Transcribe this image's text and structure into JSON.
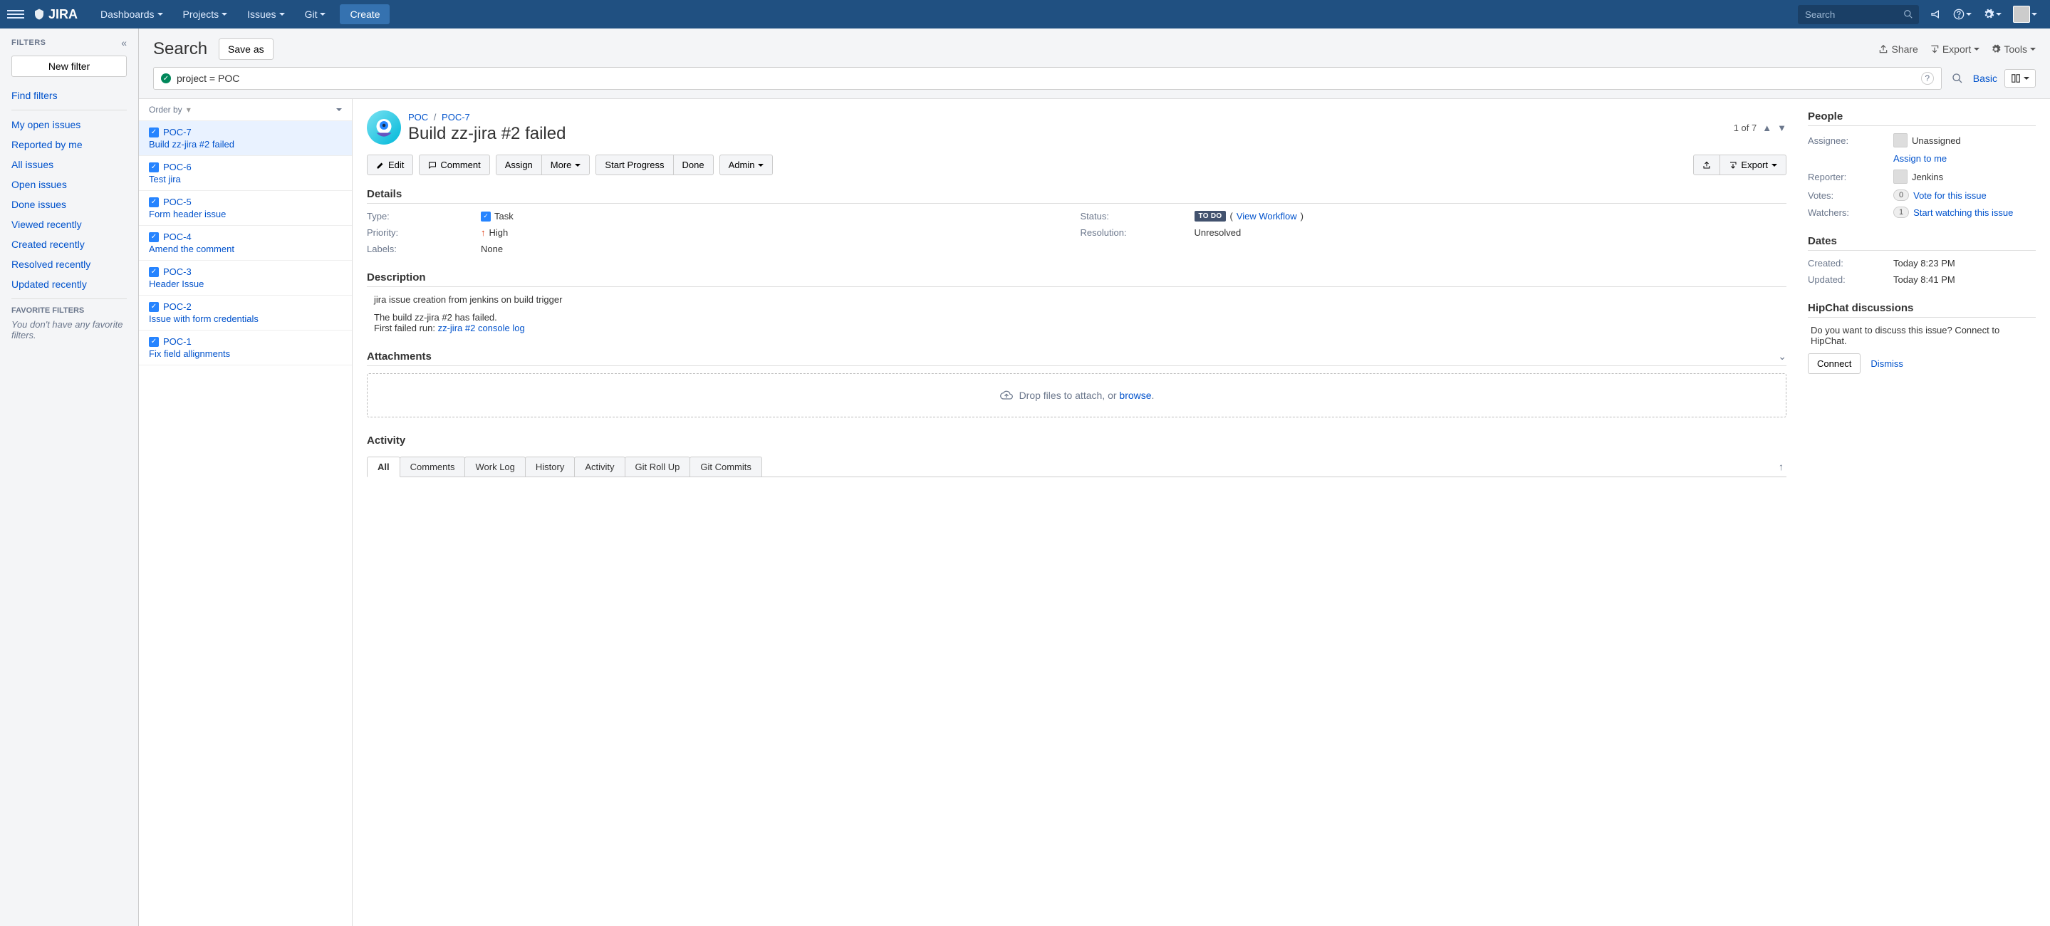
{
  "nav": {
    "logo": "JIRA",
    "items": [
      "Dashboards",
      "Projects",
      "Issues",
      "Git"
    ],
    "create": "Create",
    "search_placeholder": "Search"
  },
  "sidebar": {
    "title": "FILTERS",
    "new_filter": "New filter",
    "find_filters": "Find filters",
    "links": [
      "My open issues",
      "Reported by me",
      "All issues",
      "Open issues",
      "Done issues",
      "Viewed recently",
      "Created recently",
      "Resolved recently",
      "Updated recently"
    ],
    "fav_title": "FAVORITE FILTERS",
    "fav_empty": "You don't have any favorite filters."
  },
  "search": {
    "title": "Search",
    "save_as": "Save as",
    "share": "Share",
    "export": "Export",
    "tools": "Tools",
    "jql": "project = POC",
    "basic": "Basic"
  },
  "issues": {
    "order_by": "Order by",
    "list": [
      {
        "key": "POC-7",
        "summary": "Build zz-jira #2 failed"
      },
      {
        "key": "POC-6",
        "summary": "Test jira"
      },
      {
        "key": "POC-5",
        "summary": "Form header issue"
      },
      {
        "key": "POC-4",
        "summary": "Amend the comment"
      },
      {
        "key": "POC-3",
        "summary": "Header Issue"
      },
      {
        "key": "POC-2",
        "summary": "Issue with form credentials"
      },
      {
        "key": "POC-1",
        "summary": "Fix field allignments"
      }
    ]
  },
  "issue": {
    "project": "POC",
    "key": "POC-7",
    "title": "Build zz-jira #2 failed",
    "pager": "1 of 7",
    "actions": {
      "edit": "Edit",
      "comment": "Comment",
      "assign": "Assign",
      "more": "More",
      "start_progress": "Start Progress",
      "done": "Done",
      "admin": "Admin",
      "export": "Export"
    },
    "details": {
      "heading": "Details",
      "type_label": "Type:",
      "type_value": "Task",
      "priority_label": "Priority:",
      "priority_value": "High",
      "labels_label": "Labels:",
      "labels_value": "None",
      "status_label": "Status:",
      "status_value": "TO DO",
      "view_workflow": "View Workflow",
      "resolution_label": "Resolution:",
      "resolution_value": "Unresolved"
    },
    "description": {
      "heading": "Description",
      "line1": "jira issue creation from jenkins on build trigger",
      "line2": "The build zz-jira #2 has failed.",
      "line3_prefix": "First failed run: ",
      "line3_link": "zz-jira #2 console log"
    },
    "attachments": {
      "heading": "Attachments",
      "drop_text": "Drop files to attach, or ",
      "browse": "browse"
    },
    "activity": {
      "heading": "Activity",
      "tabs": [
        "All",
        "Comments",
        "Work Log",
        "History",
        "Activity",
        "Git Roll Up",
        "Git Commits"
      ]
    }
  },
  "people": {
    "heading": "People",
    "assignee_label": "Assignee:",
    "assignee_value": "Unassigned",
    "assign_to_me": "Assign to me",
    "reporter_label": "Reporter:",
    "reporter_value": "Jenkins",
    "votes_label": "Votes:",
    "votes_count": "0",
    "vote_link": "Vote for this issue",
    "watchers_label": "Watchers:",
    "watchers_count": "1",
    "watch_link": "Start watching this issue"
  },
  "dates": {
    "heading": "Dates",
    "created_label": "Created:",
    "created_value": "Today 8:23 PM",
    "updated_label": "Updated:",
    "updated_value": "Today 8:41 PM"
  },
  "hipchat": {
    "heading": "HipChat discussions",
    "body": "Do you want to discuss this issue? Connect to HipChat.",
    "connect": "Connect",
    "dismiss": "Dismiss"
  }
}
